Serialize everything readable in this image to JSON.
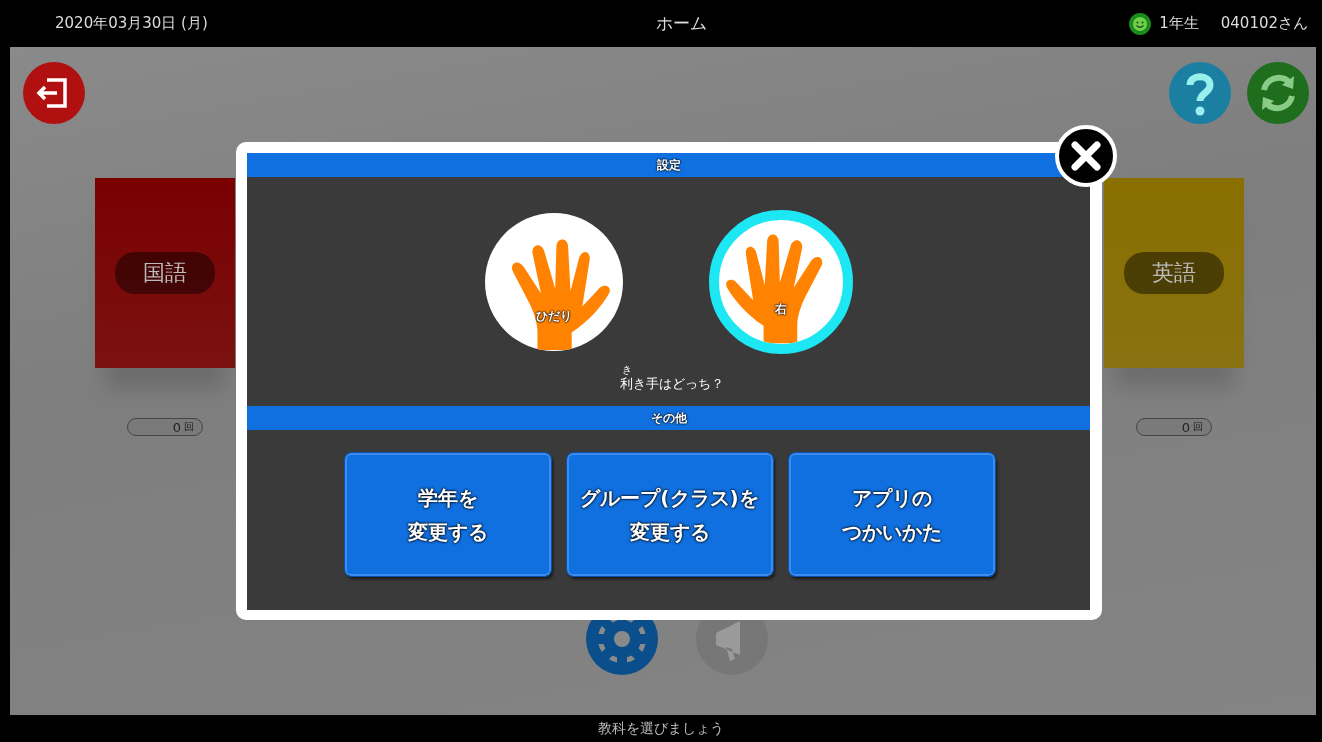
{
  "top_bar": {
    "date": "2020年03月30日 (月)",
    "title": "ホーム",
    "grade": "1年生",
    "user": "040102さん"
  },
  "subjects": [
    {
      "name": "国語",
      "count": "0",
      "unit": "回",
      "color": "#7a0000"
    },
    {
      "name": "英語",
      "count": "0",
      "unit": "回",
      "color": "#8a7000"
    }
  ],
  "dialog": {
    "settings_header": "設定",
    "hands": [
      {
        "label": "ひだり",
        "selected": false
      },
      {
        "label": "右",
        "selected": true
      }
    ],
    "question": "利き手はどっち？",
    "question_ruby": "き",
    "other_header": "その他",
    "buttons": [
      {
        "lines": [
          "学年を",
          "変更する"
        ]
      },
      {
        "lines": [
          "グループ(クラス)を",
          "変更する"
        ]
      },
      {
        "lines": [
          "アプリの",
          "つかいかた"
        ]
      }
    ]
  },
  "status_bar": "教科を選びましょう"
}
